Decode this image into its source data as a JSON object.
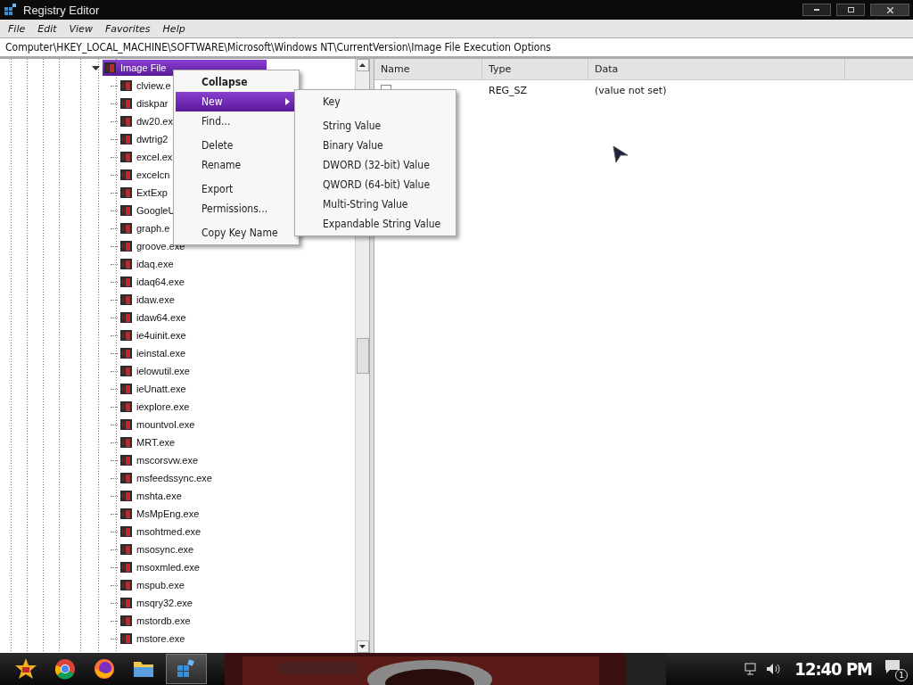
{
  "window": {
    "title": "Registry Editor"
  },
  "menu_bar": [
    "File",
    "Edit",
    "View",
    "Favorites",
    "Help"
  ],
  "address": "Computer\\HKEY_LOCAL_MACHINE\\SOFTWARE\\Microsoft\\Windows NT\\CurrentVersion\\Image File Execution Options",
  "tree": {
    "items": [
      {
        "label": "Image File",
        "selected": true,
        "expanded": true,
        "children": [
          {
            "label": "clview.e",
            "selected": false
          },
          {
            "label": "diskpar",
            "selected": false
          },
          {
            "label": "dw20.ex",
            "selected": false
          },
          {
            "label": "dwtrig2",
            "selected": false
          },
          {
            "label": "excel.ex",
            "selected": false
          },
          {
            "label": "excelcn",
            "selected": false
          },
          {
            "label": "ExtExp",
            "selected": false
          },
          {
            "label": "GoogleU",
            "selected": false
          },
          {
            "label": "graph.e",
            "selected": false
          },
          {
            "label": "groove.exe",
            "selected": false
          },
          {
            "label": "idaq.exe",
            "selected": false
          },
          {
            "label": "idaq64.exe",
            "selected": false
          },
          {
            "label": "idaw.exe",
            "selected": false
          },
          {
            "label": "idaw64.exe",
            "selected": false
          },
          {
            "label": "ie4uinit.exe",
            "selected": false
          },
          {
            "label": "ieinstal.exe",
            "selected": false
          },
          {
            "label": "ielowutil.exe",
            "selected": false
          },
          {
            "label": "ieUnatt.exe",
            "selected": false
          },
          {
            "label": "iexplore.exe",
            "selected": false
          },
          {
            "label": "mountvol.exe",
            "selected": false
          },
          {
            "label": "MRT.exe",
            "selected": false
          },
          {
            "label": "mscorsvw.exe",
            "selected": false
          },
          {
            "label": "msfeedssync.exe",
            "selected": false
          },
          {
            "label": "mshta.exe",
            "selected": false
          },
          {
            "label": "MsMpEng.exe",
            "selected": false
          },
          {
            "label": "msohtmed.exe",
            "selected": false
          },
          {
            "label": "msosync.exe",
            "selected": false
          },
          {
            "label": "msoxmled.exe",
            "selected": false
          },
          {
            "label": "mspub.exe",
            "selected": false
          },
          {
            "label": "msqry32.exe",
            "selected": false
          },
          {
            "label": "mstordb.exe",
            "selected": false
          },
          {
            "label": "mstore.exe",
            "selected": false
          }
        ]
      }
    ]
  },
  "values": {
    "columns": [
      "Name",
      "Type",
      "Data"
    ],
    "rows": [
      {
        "type": "REG_SZ",
        "data": "(value not set)"
      }
    ]
  },
  "context_menu": {
    "groups": [
      [
        {
          "label": "Collapse",
          "default": true,
          "selected": false,
          "submenu": false
        },
        {
          "label": "New",
          "default": false,
          "selected": true,
          "submenu": true
        },
        {
          "label": "Find...",
          "default": false,
          "selected": false,
          "submenu": false
        }
      ],
      [
        {
          "label": "Delete",
          "default": false,
          "selected": false,
          "submenu": false
        },
        {
          "label": "Rename",
          "default": false,
          "selected": false,
          "submenu": false
        }
      ],
      [
        {
          "label": "Export",
          "default": false,
          "selected": false,
          "submenu": false
        },
        {
          "label": "Permissions...",
          "default": false,
          "selected": false,
          "submenu": false
        }
      ],
      [
        {
          "label": "Copy Key Name",
          "default": false,
          "selected": false,
          "submenu": false
        }
      ]
    ]
  },
  "submenu": {
    "groups": [
      [
        "Key"
      ],
      [
        "String Value",
        "Binary Value",
        "DWORD (32-bit) Value",
        "QWORD (64-bit) Value",
        "Multi-String Value",
        "Expandable String Value"
      ]
    ]
  },
  "taskbar": {
    "apps": [
      {
        "kind": "start",
        "selected": false
      },
      {
        "kind": "chrome",
        "selected": false
      },
      {
        "kind": "firefox",
        "selected": false
      },
      {
        "kind": "folder",
        "selected": false
      },
      {
        "kind": "registry",
        "selected": true
      }
    ],
    "clock": "12:40 PM",
    "notification_count": "1"
  }
}
